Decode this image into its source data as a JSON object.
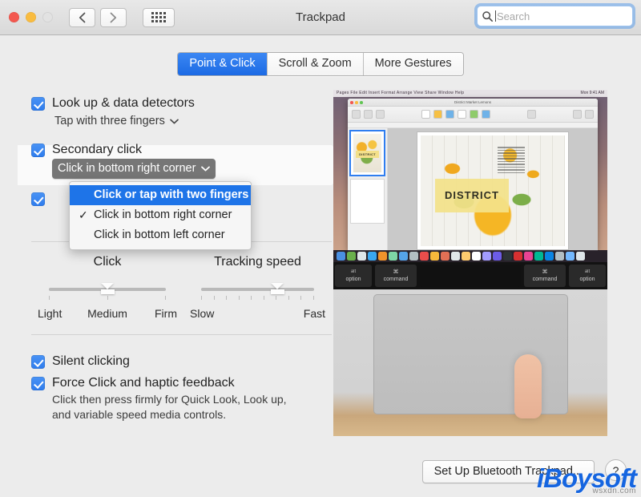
{
  "window": {
    "title": "Trackpad",
    "traffic_lights": [
      "close",
      "minimize",
      "zoom-disabled"
    ],
    "nav": {
      "back": "back-arrow",
      "forward": "forward-arrow",
      "grid": "show-all-grid"
    }
  },
  "search": {
    "placeholder": "Search",
    "value": "",
    "icon": "search-icon"
  },
  "tabs": [
    {
      "label": "Point & Click",
      "active": true
    },
    {
      "label": "Scroll & Zoom",
      "active": false
    },
    {
      "label": "More Gestures",
      "active": false
    }
  ],
  "options": {
    "lookup": {
      "label": "Look up & data detectors",
      "checked": true,
      "popup_value": "Tap with three fingers"
    },
    "secondary_click": {
      "label": "Secondary click",
      "checked": true,
      "popup_value": "Click in bottom right corner",
      "menu_open": true,
      "menu_items": [
        {
          "label": "Click or tap with two fingers",
          "checked": false,
          "highlighted": true
        },
        {
          "label": "Click in bottom right corner",
          "checked": true,
          "highlighted": false
        },
        {
          "label": "Click in bottom left corner",
          "checked": false,
          "highlighted": false
        }
      ]
    },
    "tap_to_click": {
      "checked": true
    },
    "silent_clicking": {
      "label": "Silent clicking",
      "checked": true
    },
    "force_click": {
      "label": "Force Click and haptic feedback",
      "checked": true,
      "description_line1": "Click then press firmly for Quick Look, Look up,",
      "description_line2": "and variable speed media controls."
    }
  },
  "sliders": {
    "click": {
      "title": "Click",
      "labels": [
        "Light",
        "Medium",
        "Firm"
      ],
      "ticks": 3,
      "value_percent": 50
    },
    "tracking_speed": {
      "title": "Tracking speed",
      "labels": [
        "Slow",
        "Fast"
      ],
      "ticks": 10,
      "value_percent": 68
    }
  },
  "preview": {
    "name": "trackpad-gesture-video",
    "menubar_apps": "Pages  File  Edit  Insert  Format  Arrange  View  Share  Window  Help",
    "menubar_status": "Mon 9:41 AM",
    "app_window_title": "District Market Lemons",
    "page_caption": "DISTRICT",
    "keys": [
      {
        "top": "alt",
        "bottom": "option"
      },
      {
        "top": "⌘",
        "bottom": "command"
      },
      {
        "top": "",
        "bottom": ""
      },
      {
        "top": "⌘",
        "bottom": "command"
      },
      {
        "top": "alt",
        "bottom": "option"
      }
    ]
  },
  "footer": {
    "bluetooth_button": "Set Up Bluetooth Trackpad...",
    "help_button": "?"
  },
  "watermark": {
    "main": "iBoysoft",
    "sub": "wsxdn.com"
  },
  "colors": {
    "accent_blue": "#2e7ced",
    "tab_active": "#1c6ae4",
    "menu_highlight": "#1e74e8",
    "popup_dark": "#767676",
    "window_bg": "#ececec",
    "watermark_blue": "#1565e0"
  }
}
